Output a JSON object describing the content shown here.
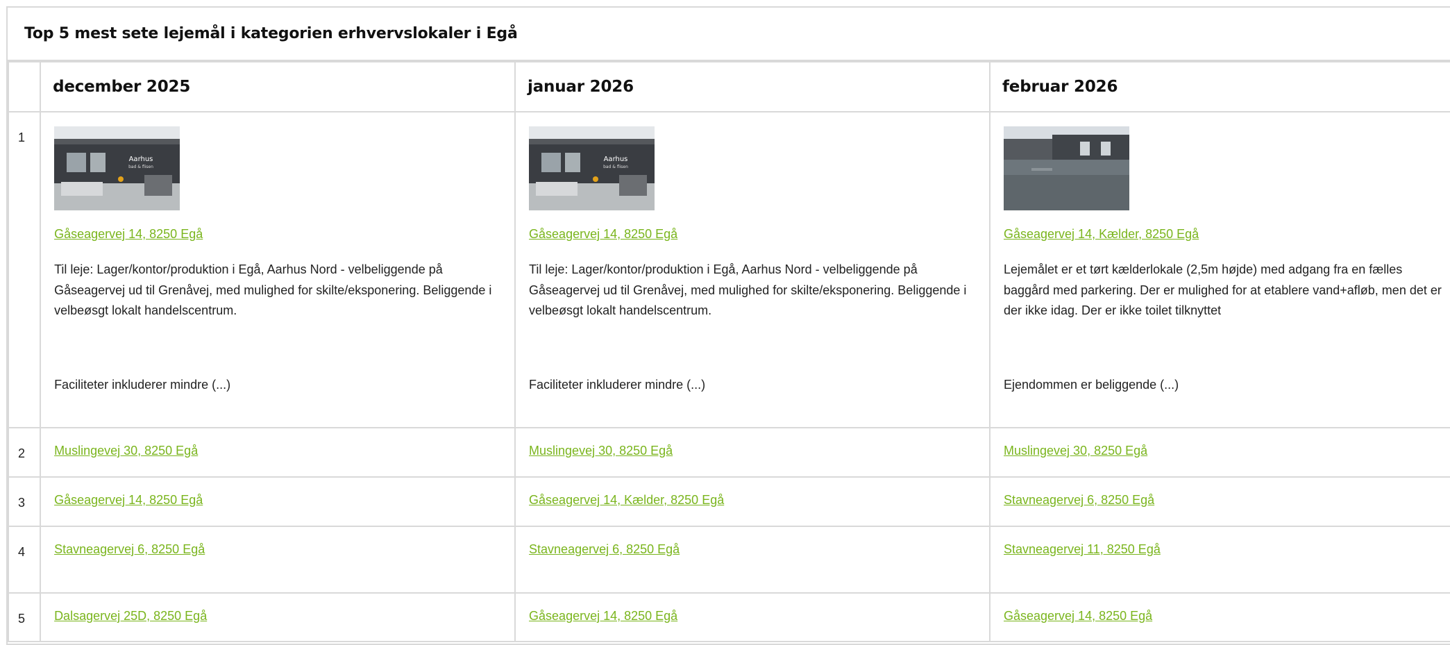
{
  "title": "Top 5 mest sete lejemål i kategorien erhvervslokaler i Egå",
  "months": [
    "december 2025",
    "januar 2026",
    "februar 2026"
  ],
  "ranks": [
    "1",
    "2",
    "3",
    "4",
    "5"
  ],
  "featured": [
    {
      "image": "building-front-photo",
      "link": "Gåseagervej 14, 8250 Egå",
      "description": "Til leje: Lager/kontor/produktion i Egå,  Aarhus Nord - velbeliggende på Gåseagervej ud til Grenåvej, med mulighed for skilte/eksponering. Beliggende i velbeøsgt lokalt handelscentrum.",
      "more": "Faciliteter inkluderer mindre (...)"
    },
    {
      "image": "building-front-photo",
      "link": "Gåseagervej 14, 8250 Egå",
      "description": "Til leje: Lager/kontor/produktion i Egå,  Aarhus Nord - velbeliggende på Gåseagervej ud til Grenåvej, med mulighed for skilte/eksponering. Beliggende i velbeøsgt lokalt handelscentrum.",
      "more": "Faciliteter inkluderer mindre (...)"
    },
    {
      "image": "courtyard-photo",
      "link": "Gåseagervej 14, Kælder, 8250 Egå",
      "description": "Lejemålet er et tørt kælderlokale (2,5m højde) med adgang fra en fælles baggård med parkering. Der er mulighed for at etablere vand+afløb, men det er der ikke idag. Der er ikke toilet tilknyttet",
      "more": "Ejendommen er beliggende (...)"
    }
  ],
  "rows": [
    [
      "Muslingevej 30, 8250 Egå",
      "Muslingevej 30, 8250 Egå",
      "Muslingevej 30, 8250 Egå"
    ],
    [
      "Gåseagervej 14, 8250 Egå",
      "Gåseagervej 14, Kælder, 8250 Egå",
      "Stavneagervej 6, 8250 Egå"
    ],
    [
      "Stavneagervej 6, 8250 Egå",
      "Stavneagervej 6, 8250 Egå",
      "Stavneagervej 11, 8250 Egå"
    ],
    [
      "Dalsagervej 25D, 8250 Egå",
      "Gåseagervej 14, 8250 Egå",
      "Gåseagervej 14, 8250 Egå"
    ]
  ],
  "colors": {
    "link": "#7ab51d",
    "border": "#d9d9d9"
  }
}
